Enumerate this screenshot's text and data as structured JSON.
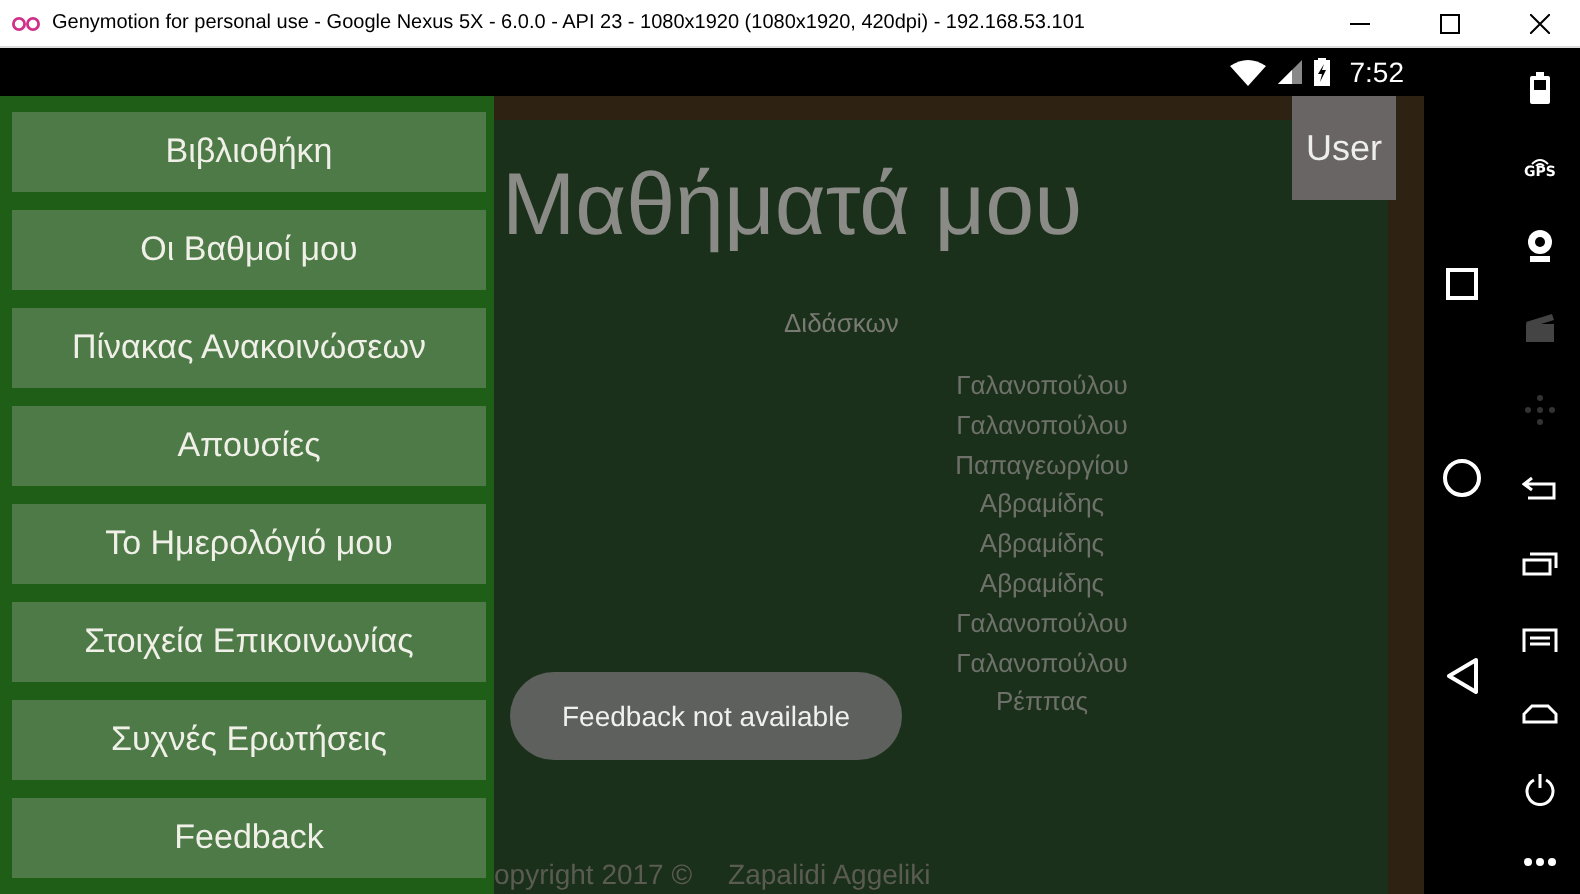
{
  "window": {
    "title": "Genymotion for personal use - Google Nexus 5X - 6.0.0 - API 23 - 1080x1920 (1080x1920, 420dpi) - 192.168.53.101"
  },
  "status_bar": {
    "time": "7:52"
  },
  "drawer": {
    "items": [
      {
        "label": "Βιβλιοθήκη"
      },
      {
        "label": "Οι Βαθμοί μου"
      },
      {
        "label": "Πίνακας Ανακοινώσεων"
      },
      {
        "label": "Απουσίες"
      },
      {
        "label": "Το Ημερολόγιό μου"
      },
      {
        "label": "Στοιχεία Επικοινωνίας"
      },
      {
        "label": "Συχνές Ερωτήσεις"
      },
      {
        "label": "Feedback"
      }
    ]
  },
  "page": {
    "title": "Μαθήματά μου",
    "user_button": "User",
    "column_header": "Διδάσκων",
    "teachers": [
      "Γαλανοπούλου",
      "Γαλανοπούλου",
      "Παπαγεωργίου",
      "Αβραμίδης",
      "Αβραμίδης",
      "Αβραμίδης",
      "Γαλανοπούλου",
      "Γαλανοπούλου",
      "Ρέππας"
    ],
    "footer_copyright": "opyright 2017 ©",
    "footer_author": "Zapalidi Aggeliki"
  },
  "toast": {
    "text": "Feedback not available"
  },
  "emulator_toolbar": {
    "gps_label": "GPS"
  }
}
